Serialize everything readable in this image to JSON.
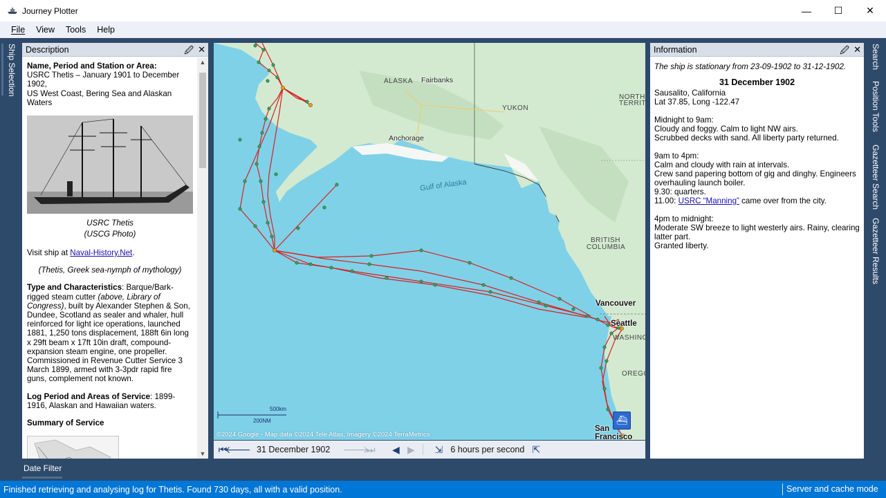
{
  "window": {
    "title": "Journey Plotter",
    "minimize": "—",
    "maximize": "☐",
    "close": "✕"
  },
  "menu": [
    "File",
    "View",
    "Tools",
    "Help"
  ],
  "left_rail": {
    "tab": "Ship Selection"
  },
  "right_rail": {
    "tabs": [
      "Search",
      "Position Tools",
      "Gazetteer Search",
      "Gazetteer Results"
    ]
  },
  "description": {
    "panel_title": "Description",
    "heading1": "Name, Period and Station or Area",
    "line1": "USRC Thetis – January 1901 to December 1902,",
    "line2": "US West Coast, Bering Sea and Alaskan Waters",
    "caption1": "USRC Thetis",
    "caption2": "(USCG Photo)",
    "visit_prefix": "Visit ship at ",
    "visit_link": "Naval-History.Net",
    "visit_suffix": ".",
    "myth": "(Thetis, Greek sea-nymph of mythology)",
    "type_heading": "Type and Characteristics",
    "type_intro": ": Barque/Bark-rigged steam cutter ",
    "type_italic": "(above, Library of Congress)",
    "type_text": ", built by Alexander Stephen & Son, Dundee, Scotland as sealer and whaler, hull reinforced for light ice operations, launched 1881, 1,250 tons displacement, 188ft 6in long x 29ft beam x 17ft 10in draft, compound-expansion steam engine, one propeller. Commissioned in Revenue Cutter Service 3 March 1899, armed with 3-3pdr rapid fire guns, complement not known.",
    "log_heading": "Log Period and Areas of Service",
    "log_text": ": 1899-1916, Alaskan and Hawaiian waters.",
    "summary_heading": "Summary of Service"
  },
  "map": {
    "labels": {
      "alaska": "ALASKA",
      "fairbanks": "Fairbanks",
      "yukon": "YUKON",
      "northwest": "NORTH",
      "territories": "TERRITO",
      "anchorage": "Anchorage",
      "gulf": "Gulf of Alaska",
      "british": "BRITISH",
      "columbia": "COLUMBIA",
      "vancouver": "Vancouver",
      "seattle": "Seattle",
      "washington": "WASHING",
      "oregon": "OREGO",
      "sanfran": "San Francisco"
    },
    "scale_km": "500km",
    "scale_nm": "200NM",
    "credits": "©2024 Google - Map data ©2024 Tele Atlas, Imagery ©2024 TerraMetrics",
    "toolbar_date": "31 December 1902",
    "toolbar_speed": "6 hours per second"
  },
  "information": {
    "panel_title": "Information",
    "stationary": "The ship is stationary from 23-09-1902 to 31-12-1902.",
    "date": "31 December 1902",
    "place": "Sausalito, California",
    "latlong": "Lat 37.85, Long -122.47",
    "p1_title": "Midnight to 9am:",
    "p1_l1": "Cloudy and foggy. Calm to light NW airs.",
    "p1_l2": "Scrubbed decks with sand. All liberty party returned.",
    "p2_title": "9am to 4pm:",
    "p2_l1": "Calm and cloudy with rain at intervals.",
    "p2_l2": "Crew sand papering bottom of gig and dinghy. Engineers overhauling launch boiler.",
    "p2_l3": "9.30: quarters.",
    "p2_l4_prefix": "11.00: ",
    "p2_l4_link": "USRC “Manning”",
    "p2_l4_suffix": " came over from the city.",
    "p3_title": "4pm to midnight:",
    "p3_l1": "Moderate SW breeze to light westerly airs. Rainy, clearing latter part.",
    "p3_l2": "Granted liberty."
  },
  "date_filter": "Date Filter",
  "status": {
    "message": "Finished retrieving and analysing log for Thetis. Found 730 days, all with a valid position.",
    "mode": "Server and cache mode"
  },
  "colors": {
    "frame": "#2d4a6b",
    "status": "#0076d6",
    "sea": "#7fd1e8",
    "land": "#d3ead0",
    "track": "#d92020",
    "point": "#3aa35a"
  }
}
